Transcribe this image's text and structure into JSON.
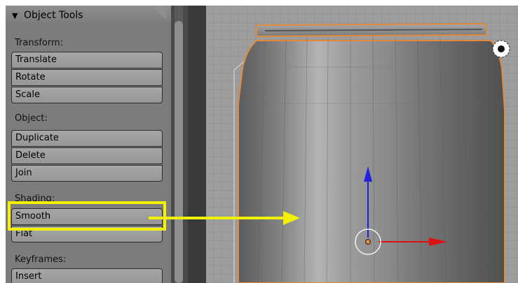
{
  "panel": {
    "title": "Object Tools",
    "sections": {
      "transform": {
        "label": "Transform:",
        "buttons": [
          "Translate",
          "Rotate",
          "Scale"
        ]
      },
      "object": {
        "label": "Object:",
        "buttons": [
          "Duplicate",
          "Delete",
          "Join"
        ]
      },
      "shading": {
        "label": "Shading:",
        "buttons": [
          "Smooth",
          "Flat"
        ]
      },
      "keyframes": {
        "label": "Keyframes:",
        "buttons": [
          "Insert"
        ]
      }
    }
  },
  "colors": {
    "highlight": "#f2f200",
    "selection_outline": "#e08a3a",
    "axis_z": "#2222dd",
    "axis_x": "#dd1111"
  },
  "icons": {
    "collapse": "triangle-down-icon",
    "resize_grip": "grip-icon",
    "camera_target": "target-icon",
    "object_origin": "origin-icon",
    "highlight_arrow": "arrow-right-icon"
  }
}
